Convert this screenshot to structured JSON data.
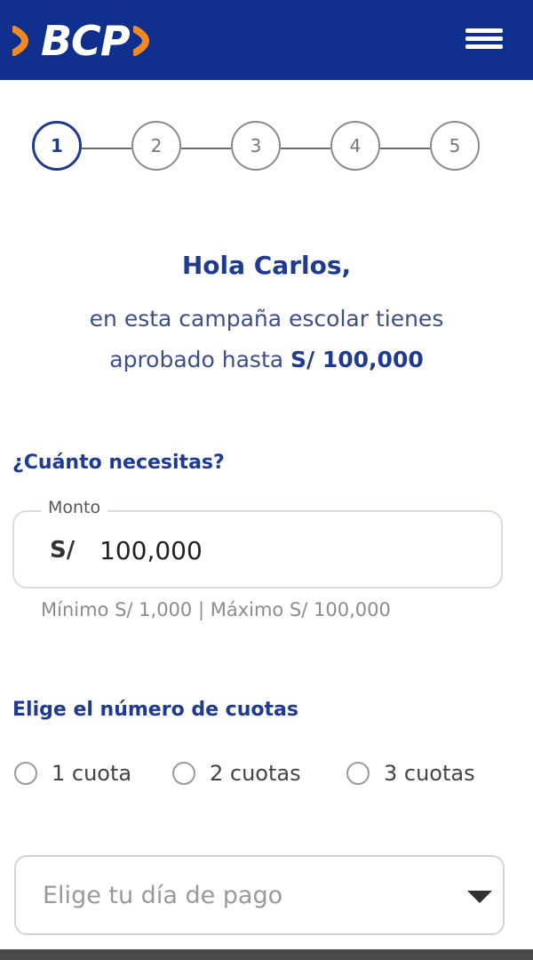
{
  "header": {
    "logo_text": "BCP",
    "menu_icon": "hamburger-menu-icon",
    "background": "#0f2f8f"
  },
  "stepper": {
    "steps": [
      "1",
      "2",
      "3",
      "4",
      "5"
    ],
    "active_index": 0
  },
  "greeting": {
    "title": "Hola Carlos,",
    "line1": "en esta campaña escolar tienes",
    "line2_prefix": "aprobado hasta ",
    "line2_amount": "S/ 100,000"
  },
  "amount_section": {
    "label": "¿Cuánto necesitas?",
    "field_legend": "Monto",
    "currency": "S/",
    "value": "100,000",
    "limits_text": "Mínimo S/ 1,000   |   Máximo S/ 100,000"
  },
  "quotas_section": {
    "label": "Elige el número de cuotas",
    "options": [
      "1 cuota",
      "2 cuotas",
      "3 cuotas"
    ]
  },
  "payment_day": {
    "placeholder": "Elige tu día de pago"
  }
}
